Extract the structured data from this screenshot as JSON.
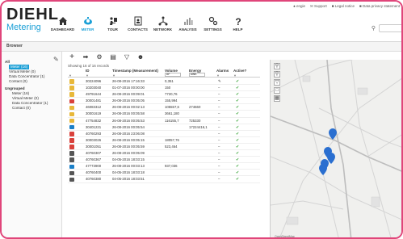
{
  "app": {
    "brand": "DIEHL",
    "product": "Metering"
  },
  "utility": {
    "user": "engie",
    "support": "Support",
    "legal": "Legal notice",
    "privacy": "Data privacy statement"
  },
  "nav": [
    {
      "label": "DASHBOARD",
      "icon": "home-icon"
    },
    {
      "label": "METER",
      "icon": "meter-icon",
      "active": true
    },
    {
      "label": "TOUR",
      "icon": "tour-icon"
    },
    {
      "label": "CONTACTS",
      "icon": "contacts-icon"
    },
    {
      "label": "NETWORK",
      "icon": "network-icon"
    },
    {
      "label": "ANALYSIS",
      "icon": "analysis-icon"
    },
    {
      "label": "SETTINGS",
      "icon": "settings-icon"
    },
    {
      "label": "HELP",
      "icon": "help-icon"
    }
  ],
  "browser_tab": "Browser",
  "tree": [
    {
      "label": "All",
      "level": 0
    },
    {
      "label": "Meter (16)",
      "level": 1,
      "selected": true
    },
    {
      "label": "Virtual Meter (0)",
      "level": 1
    },
    {
      "label": "Data Concentrator (1)",
      "level": 1
    },
    {
      "label": "Contact (0)",
      "level": 1
    },
    {
      "label": "Ungrouped",
      "level": 0
    },
    {
      "label": "Meter (16)",
      "level": 2
    },
    {
      "label": "Virtual Meter (0)",
      "level": 2
    },
    {
      "label": "Data Concentrator (1)",
      "level": 2
    },
    {
      "label": "Contact (0)",
      "level": 2
    }
  ],
  "table": {
    "showing": "Showing 16 of 16 records",
    "headers": {
      "id": "ID",
      "timestamp": "Timestamp (Measurement)",
      "volume": "Volume",
      "energy": "Energy",
      "alarm": "Alarms",
      "active": "Active?"
    },
    "volume_unit": "m³",
    "energy_unit": "kWh",
    "rows": [
      {
        "color": "#e8b83a",
        "id": "30224096",
        "ts": "26-08-2016 17:16:33",
        "vol": "0,351",
        "energy": "",
        "alarm": "alarm",
        "active": "✔"
      },
      {
        "color": "#e8b83a",
        "id": "10203040",
        "ts": "01-07-2016 00:00:00",
        "vol": "150",
        "energy": "",
        "alarm": "–",
        "active": "✔"
      },
      {
        "color": "#e8b83a",
        "id": "49791644",
        "ts": "26-08-2016 00:09:01",
        "vol": "7720,76",
        "energy": "",
        "alarm": "–",
        "active": "✔"
      },
      {
        "color": "#d9413b",
        "id": "30001481",
        "ts": "26-08-2016 00:05:05",
        "vol": "155,994",
        "energy": "",
        "alarm": "–",
        "active": "✔"
      },
      {
        "color": "#e8b83a",
        "id": "46083312",
        "ts": "26-08-2016 00:02:13",
        "vol": "105557,6",
        "energy": "274660",
        "alarm": "–",
        "active": "✔"
      },
      {
        "color": "#e8b83a",
        "id": "30001619",
        "ts": "26-08-2016 00:05:58",
        "vol": "3661,180",
        "energy": "",
        "alarm": "–",
        "active": "✔"
      },
      {
        "color": "#e8b83a",
        "id": "47754832",
        "ts": "26-08-2016 00:05:53",
        "vol": "116155,7",
        "energy": "725330",
        "alarm": "–",
        "active": "✔"
      },
      {
        "color": "#1a7fc8",
        "id": "30401221",
        "ts": "26-08-2016 00:05:54",
        "vol": "",
        "energy": "17224416,1",
        "alarm": "–",
        "active": "✔"
      },
      {
        "color": "#d9413b",
        "id": "40760293",
        "ts": "26-08-2016 23:06:08",
        "vol": "",
        "energy": "",
        "alarm": "–",
        "active": "✔"
      },
      {
        "color": "#d9413b",
        "id": "30003026",
        "ts": "26-08-2016 00:05:15",
        "vol": "18057,76",
        "energy": "",
        "alarm": "–",
        "active": "✔"
      },
      {
        "color": "#d9413b",
        "id": "30001051",
        "ts": "26-08-2016 00:05:59",
        "vol": "523,464",
        "energy": "",
        "alarm": "–",
        "active": "✔"
      },
      {
        "color": "#555555",
        "id": "40760307",
        "ts": "26-08-2016 00:05:09",
        "vol": "",
        "energy": "",
        "alarm": "–",
        "active": "✔"
      },
      {
        "color": "#555555",
        "id": "40760367",
        "ts": "04-05-2016 18:03:15",
        "vol": "",
        "energy": "",
        "alarm": "–",
        "active": "✔"
      },
      {
        "color": "#1a7fc8",
        "id": "47773900",
        "ts": "26-08-2016 00:03:13",
        "vol": "937,036",
        "energy": "",
        "alarm": "–",
        "active": "✔"
      },
      {
        "color": "#555555",
        "id": "40760400",
        "ts": "04-05-2016 18:03:18",
        "vol": "",
        "energy": "",
        "alarm": "–",
        "active": "✔"
      },
      {
        "color": "#555555",
        "id": "40760380",
        "ts": "04-05-2016 18:03:51",
        "vol": "",
        "energy": "",
        "alarm": "–",
        "active": "✔"
      }
    ]
  },
  "map": {
    "credit": "OpenStreetMap"
  }
}
